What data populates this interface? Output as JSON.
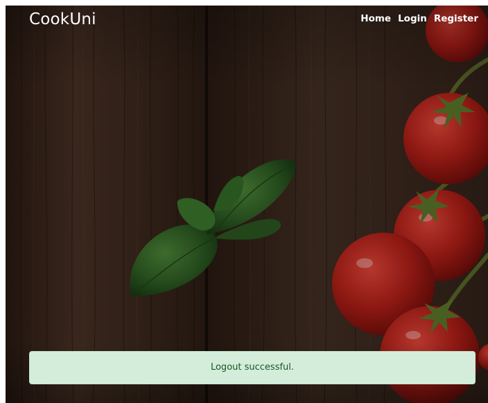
{
  "header": {
    "brand": "CookUni",
    "nav": [
      "Home",
      "Login",
      "Register"
    ]
  },
  "alert": {
    "message": "Logout successful.",
    "type": "success"
  },
  "background": {
    "image": "wooden table with basil leaves and cherry tomatoes"
  },
  "colors": {
    "alert_bg": "#d4edda",
    "alert_text": "#155724",
    "nav_text": "#ffffff",
    "wood": "#3a271c"
  }
}
